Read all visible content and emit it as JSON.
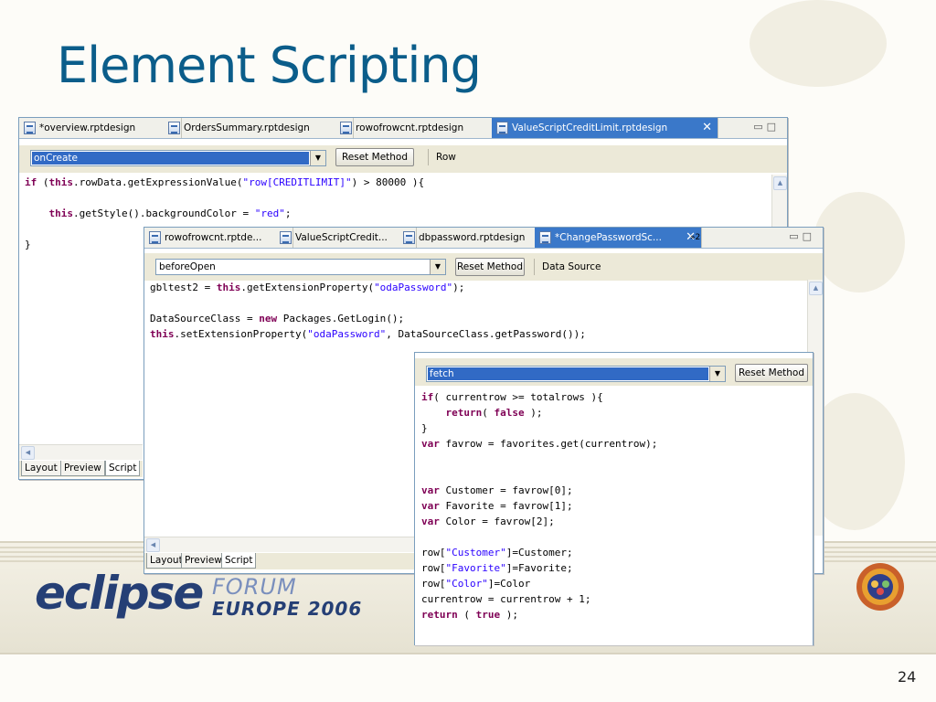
{
  "slide": {
    "title": "Element Scripting",
    "page_number": "24"
  },
  "logo": {
    "eclipse": "eclipse",
    "forum": "FORUM",
    "europe": "EUROPE 2006"
  },
  "win1": {
    "tabs": [
      {
        "label": "*overview.rptdesign"
      },
      {
        "label": "OrdersSummary.rptdesign"
      },
      {
        "label": "rowofrowcnt.rptdesign"
      },
      {
        "label": "ValueScriptCreditLimit.rptdesign",
        "active": true
      }
    ],
    "method": "onCreate",
    "reset_label": "Reset Method",
    "context": "Row",
    "code": [
      "if (this.rowData.getExpressionValue(\"row[CREDITLIMIT]\") > 80000 ){",
      "",
      "    this.getStyle().backgroundColor = \"red\";",
      "",
      "}"
    ],
    "bottom_tabs": [
      "Layout",
      "Preview",
      "Script"
    ],
    "active_bottom_tab": "Script"
  },
  "win2": {
    "tabs": [
      {
        "label": "rowofrowcnt.rptde..."
      },
      {
        "label": "ValueScriptCredit..."
      },
      {
        "label": "dbpassword.rptdesign"
      },
      {
        "label": "*ChangePasswordSc...",
        "active": true
      }
    ],
    "overflow": "»2",
    "method": "beforeOpen",
    "reset_label": "Reset Method",
    "context": "Data Source",
    "code": [
      "gbltest2 = this.getExtensionProperty(\"odaPassword\");",
      "",
      "DataSourceClass = new Packages.GetLogin();",
      "this.setExtensionProperty(\"odaPassword\", DataSourceClass.getPassword());"
    ],
    "bottom_tabs": [
      "Layout",
      "Preview",
      "Script"
    ],
    "active_bottom_tab": "Script"
  },
  "win3": {
    "method": "fetch",
    "reset_label": "Reset Method",
    "code": [
      "if( currentrow >= totalrows ){",
      "    return( false );",
      "}",
      "var favrow = favorites.get(currentrow);",
      "",
      "",
      "var Customer = favrow[0];",
      "var Favorite = favrow[1];",
      "var Color = favrow[2];",
      "",
      "row[\"Customer\"]=Customer;",
      "row[\"Favorite\"]=Favorite;",
      "row[\"Color\"]=Color",
      "currentrow = currentrow + 1;",
      "return ( true );"
    ]
  },
  "colors": {
    "title": "#0b5d8a",
    "active_tab": "#3a78c9",
    "keyword": "#7f0055",
    "string": "#2a00ff"
  }
}
